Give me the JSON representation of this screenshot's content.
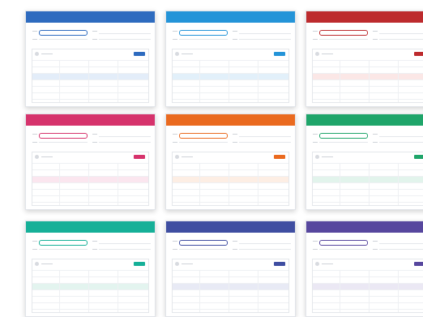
{
  "cards": [
    {
      "accent": "#2e6bbf",
      "tint": "#e3edf9"
    },
    {
      "accent": "#2494d8",
      "tint": "#e2f0fa"
    },
    {
      "accent": "#bd2b2e",
      "tint": "#fbe7e6"
    },
    {
      "accent": "#d6336c",
      "tint": "#fbe6ef"
    },
    {
      "accent": "#ea6a1f",
      "tint": "#fdeee4"
    },
    {
      "accent": "#1fa56a",
      "tint": "#e2f4ec"
    },
    {
      "accent": "#16b098",
      "tint": "#e3f4ef"
    },
    {
      "accent": "#3f4ea1",
      "tint": "#e8eaf5"
    },
    {
      "accent": "#57479e",
      "tint": "#ebe8f4"
    }
  ]
}
